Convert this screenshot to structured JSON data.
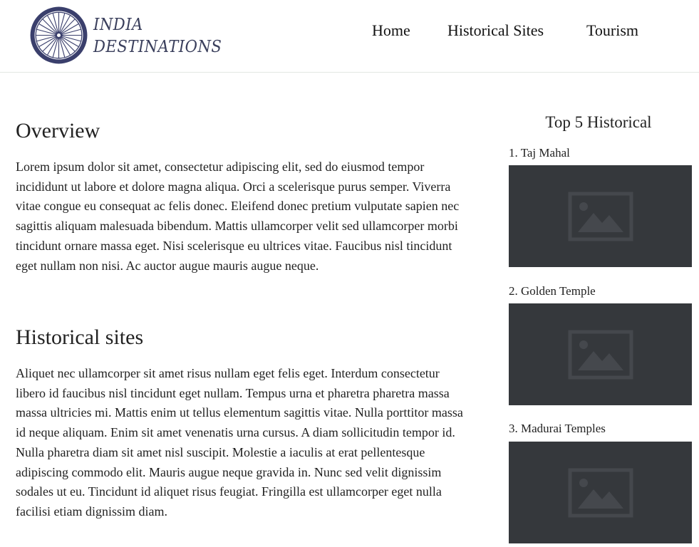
{
  "brand": {
    "line1": "INDIA",
    "line2": "DESTINATIONS"
  },
  "nav": {
    "home": "Home",
    "historical_sites": "Historical Sites",
    "tourism": "Tourism"
  },
  "overview": {
    "title": "Overview",
    "text": "Lorem ipsum dolor sit amet, consectetur adipiscing elit, sed do eiusmod tempor incididunt ut labore et dolore magna aliqua. Orci a scelerisque purus semper. Viverra vitae congue eu consequat ac felis donec. Eleifend donec pretium vulputate sapien nec sagittis aliquam malesuada bibendum. Mattis ullamcorper velit sed ullamcorper morbi tincidunt ornare massa eget. Nisi scelerisque eu ultrices vitae. Faucibus nisl tincidunt eget nullam non nisi. Ac auctor augue mauris augue neque."
  },
  "historical": {
    "title": "Historical sites",
    "text": "Aliquet nec ullamcorper sit amet risus nullam eget felis eget. Interdum consectetur libero id faucibus nisl tincidunt eget nullam. Tempus urna et pharetra pharetra massa massa ultricies mi. Mattis enim ut tellus elementum sagittis vitae. Nulla porttitor massa id neque aliquam. Enim sit amet venenatis urna cursus. A diam sollicitudin tempor id. Nulla pharetra diam sit amet nisl suscipit. Molestie a iaculis at erat pellentesque adipiscing commodo elit. Mauris augue neque gravida in. Nunc sed velit dignissim sodales ut eu. Tincidunt id aliquet risus feugiat. Fringilla est ullamcorper eget nulla facilisi etiam dignissim diam."
  },
  "sidebar": {
    "title": "Top 5 Historical",
    "items": [
      {
        "label": "1. Taj Mahal",
        "image_icon": "image-placeholder-icon"
      },
      {
        "label": "2. Golden Temple",
        "image_icon": "image-placeholder-icon"
      },
      {
        "label": "3. Madurai Temples",
        "image_icon": "image-placeholder-icon"
      }
    ]
  },
  "colors": {
    "logo_navy": "#3a3f6c",
    "image_placeholder": "#35383c",
    "header_border": "#e3e8e3"
  }
}
